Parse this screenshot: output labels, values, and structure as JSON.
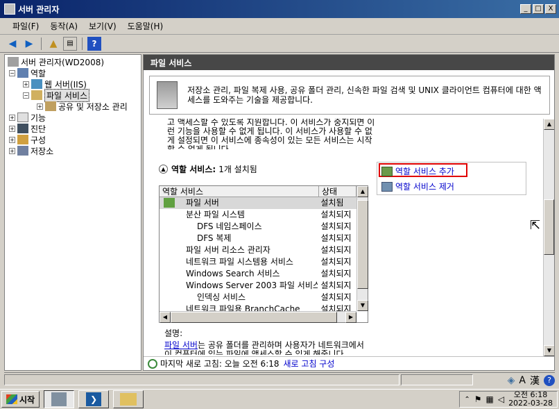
{
  "window": {
    "title": "서버 관리자",
    "minimize": "_",
    "maximize": "□",
    "close": "X"
  },
  "menu": [
    "파일(F)",
    "동작(A)",
    "보기(V)",
    "도움말(H)"
  ],
  "tree": {
    "root": "서버 관리자(WD2008)",
    "roles": "역할",
    "web_server": "웹 서버(IIS)",
    "file_services": "파일 서비스",
    "share_storage": "공유 및 저장소 관리",
    "features": "기능",
    "diagnostics": "진단",
    "configuration": "구성",
    "storage": "저장소"
  },
  "main": {
    "header": "파일 서비스",
    "description": "저장소 관리, 파일 복제 사용, 공유 폴더 관리, 신속한 파일 검색 및 UNIX 클라이언트 컴퓨터에 대한 액세스를 도와주는 기술을 제공합니다.",
    "clipped_text": "이 컴퓨터에 대해 파일, 폴더 및 공유된 파일시스템을 관리하고 액세스할 수 있도록 지원합니다. 이 서비스가 중지되면 이런 기능을 사용할 수 없게 됩니다. 이 서비스가 사용할 수 없게 설정되면 이 서비스에 종속성이 있는 모든 서비스는 시작할 수 없게 됩니다.",
    "roles_title": "역할 서비스:",
    "roles_count": "1개 설치됨",
    "list_headers": [
      "역할 서비스",
      "상태"
    ],
    "rows": [
      {
        "name": "파일 서버",
        "status": "설치됨",
        "indent": 0
      },
      {
        "name": "분산 파일 시스템",
        "status": "설치되지",
        "indent": 0
      },
      {
        "name": "DFS 네임스페이스",
        "status": "설치되지",
        "indent": 1
      },
      {
        "name": "DFS 복제",
        "status": "설치되지",
        "indent": 1
      },
      {
        "name": "파일 서버 리소스 관리자",
        "status": "설치되지",
        "indent": 0
      },
      {
        "name": "네트워크 파일 시스템용 서비스",
        "status": "설치되지",
        "indent": 0
      },
      {
        "name": "Windows Search 서비스",
        "status": "설치되지",
        "indent": 0
      },
      {
        "name": "Windows Server 2003 파일 서비스",
        "status": "설치되지",
        "indent": 0
      },
      {
        "name": "인덱싱 서비스",
        "status": "설치되지",
        "indent": 1
      },
      {
        "name": "네트워크 파일용 BranchCache",
        "status": "설치되지",
        "indent": 0
      }
    ],
    "add_role_service": "역할 서비스 추가",
    "remove_role_service": "역할 서비스 제거",
    "desc_label": "설명:",
    "desc_link": "파일 서버",
    "desc_body": "는 공유 폴더를 관리하며 사용자가 네트워크에서 이 컴퓨터에 있는 파일에 액세스할 수 있게 해줍니다.",
    "refresh_text": "마지막 새로 고침: 오늘 오전 6:18",
    "refresh_config": "새로 고침 구성"
  },
  "taskbar": {
    "start": "시작",
    "time": "오전 6:18",
    "date": "2022-03-28"
  },
  "langbar": {
    "hanja": "漢",
    "ime": "A"
  }
}
